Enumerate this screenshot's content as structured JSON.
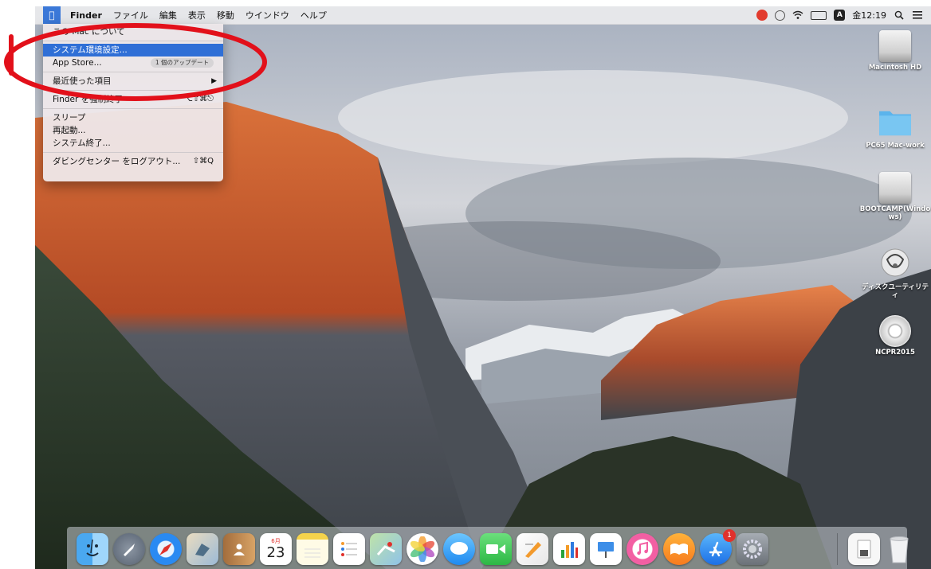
{
  "menubar": {
    "apple_icon": "apple-icon",
    "app_name": "Finder",
    "items": [
      "ファイル",
      "編集",
      "表示",
      "移動",
      "ウインドウ",
      "ヘルプ"
    ],
    "clock": "金12:19",
    "status_icons": [
      "record-icon",
      "airplay-icon",
      "wifi-icon",
      "battery-icon",
      "input-a-icon",
      "search-icon",
      "list-icon"
    ]
  },
  "apple_menu": {
    "about": "この Mac について",
    "system_prefs": "システム環境設定...",
    "app_store": "App Store...",
    "app_store_badge": "1 個のアップデート",
    "recent": "最近使った項目",
    "force_quit": "Finder を強制終了",
    "force_quit_shortcut": "⌥⇧⌘⎋",
    "sleep": "スリープ",
    "restart": "再起動...",
    "shutdown": "システム終了...",
    "logout": "ダビングセンター をログアウト...",
    "logout_shortcut": "⇧⌘Q"
  },
  "desktop": {
    "icons": [
      {
        "label": "Macintosh HD",
        "icon": "hard-drive-icon"
      },
      {
        "label": "PC65 Mac-work",
        "icon": "folder-icon"
      },
      {
        "label": "BOOTCAMP(Windo",
        "label2": "ws)",
        "icon": "hard-drive-icon"
      },
      {
        "label": "ディスクユーティリテ",
        "label2": "ィ",
        "icon": "disk-utility-icon"
      },
      {
        "label": "NCPR2015",
        "icon": "dvd-icon"
      }
    ]
  },
  "dock": {
    "calendar_day": "23",
    "calendar_month": "6月",
    "app_store_badge": "1"
  },
  "colors": {
    "annotation": "#e2101a",
    "selection": "#2f6fd6"
  }
}
